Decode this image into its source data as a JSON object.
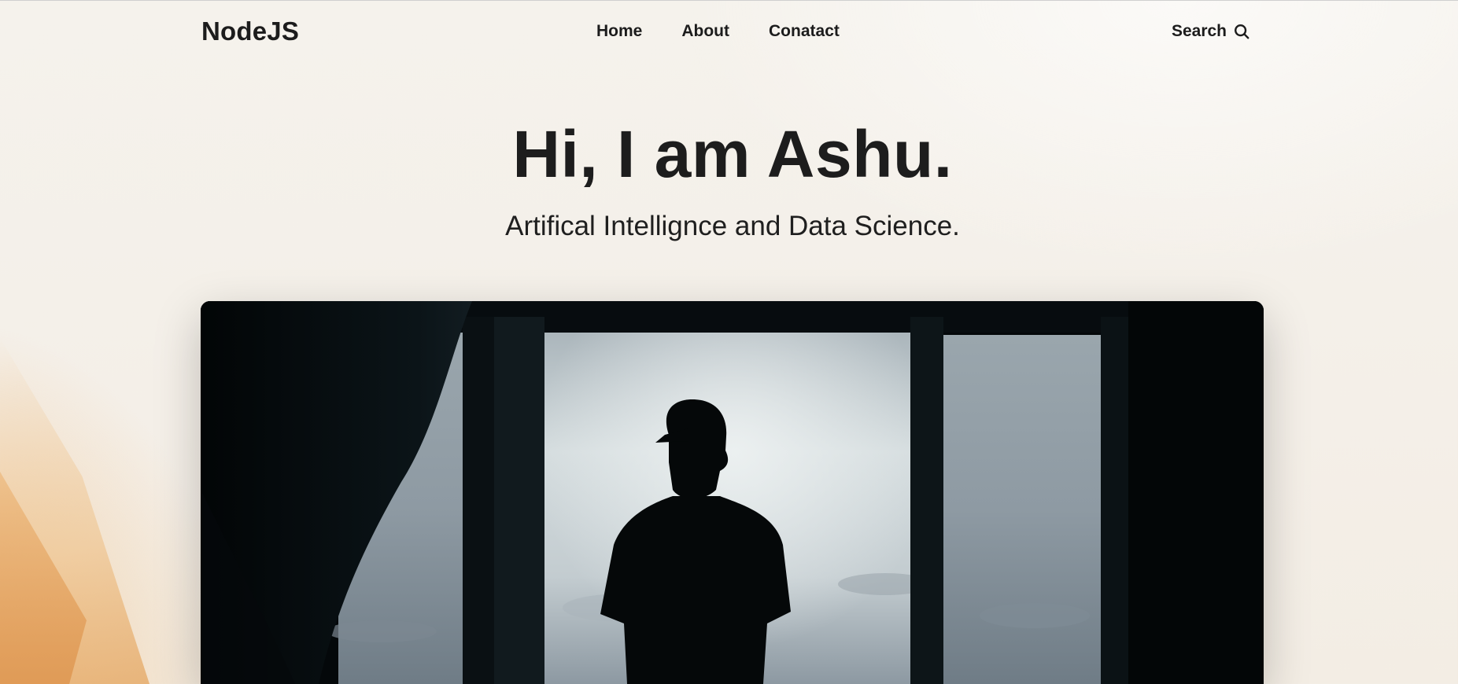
{
  "brand": "NodeJS",
  "nav": {
    "items": [
      {
        "label": "Home"
      },
      {
        "label": "About"
      },
      {
        "label": "Conatact"
      }
    ],
    "search_label": "Search",
    "search_icon": "search-icon"
  },
  "hero": {
    "title": "Hi, I am Ashu.",
    "subtitle": "Artifical Intellignce and Data Science."
  },
  "colors": {
    "text": "#1c1c1c",
    "background": "#f4efe8",
    "photo_dark": "#05090b",
    "sky": "#b9c3c8"
  }
}
